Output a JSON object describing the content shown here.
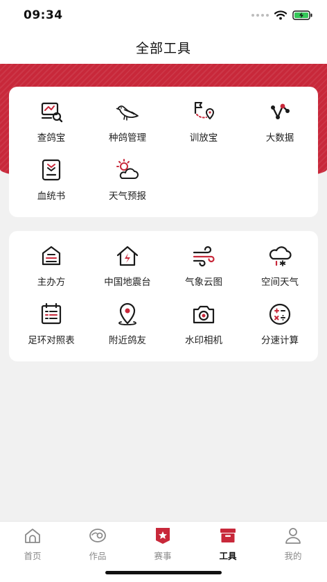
{
  "status_bar": {
    "time": "09:34"
  },
  "header": {
    "title": "全部工具"
  },
  "colors": {
    "accent": "#c8283a",
    "icon": "#1a1a1a"
  },
  "tool_groups": [
    {
      "tools": [
        {
          "label": "查鸽宝",
          "icon": "search-document-icon"
        },
        {
          "label": "种鸽管理",
          "icon": "pigeon-icon"
        },
        {
          "label": "训放宝",
          "icon": "flag-route-icon"
        },
        {
          "label": "大数据",
          "icon": "data-nodes-icon"
        },
        {
          "label": "血统书",
          "icon": "pedigree-book-icon"
        },
        {
          "label": "天气预报",
          "icon": "weather-sun-cloud-icon"
        }
      ]
    },
    {
      "tools": [
        {
          "label": "主办方",
          "icon": "organizer-house-icon"
        },
        {
          "label": "中国地震台",
          "icon": "earthquake-house-icon"
        },
        {
          "label": "气象云图",
          "icon": "wind-icon"
        },
        {
          "label": "空间天气",
          "icon": "snow-cloud-icon"
        },
        {
          "label": "足环对照表",
          "icon": "table-chart-icon"
        },
        {
          "label": "附近鸽友",
          "icon": "location-pin-icon"
        },
        {
          "label": "水印相机",
          "icon": "camera-icon"
        },
        {
          "label": "分速计算",
          "icon": "calculator-icon"
        }
      ]
    }
  ],
  "tabbar": {
    "items": [
      {
        "label": "首页",
        "icon": "home-icon",
        "active": false
      },
      {
        "label": "作品",
        "icon": "works-icon",
        "active": false
      },
      {
        "label": "赛事",
        "icon": "star-badge-icon",
        "active": false
      },
      {
        "label": "工具",
        "icon": "toolbox-icon",
        "active": true
      },
      {
        "label": "我的",
        "icon": "user-icon",
        "active": false
      }
    ]
  }
}
